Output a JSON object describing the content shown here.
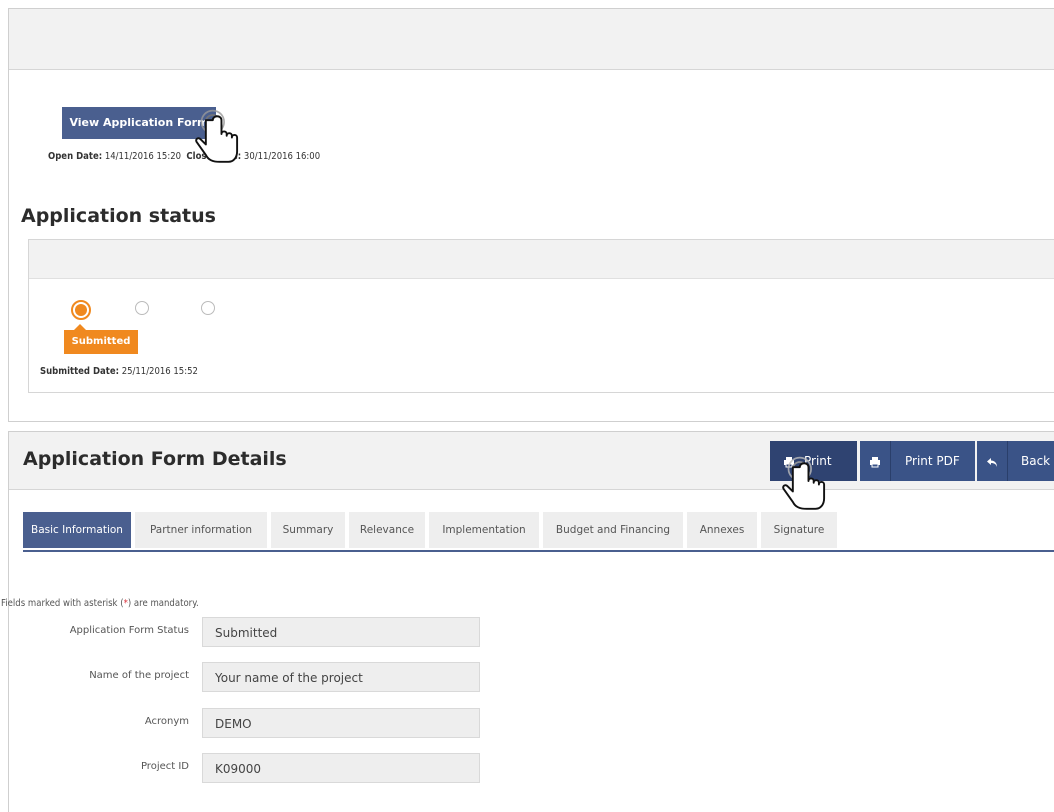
{
  "top": {
    "view_button_label": "View Application Form",
    "open_date_label": "Open Date:",
    "open_date_value": "14/11/2016 15:20",
    "close_date_label": "Close Date:",
    "close_date_value": "30/11/2016 16:00"
  },
  "status": {
    "heading": "Application status",
    "badge": "Submitted",
    "submitted_date_label": "Submitted Date:",
    "submitted_date_value": "25/11/2016 15:52"
  },
  "details": {
    "title": "Application Form Details",
    "toolbar": {
      "print": "Print",
      "print_pdf": "Print PDF",
      "back": "Back"
    },
    "tabs": [
      "Basic Information",
      "Partner information",
      "Summary",
      "Relevance",
      "Implementation",
      "Budget and Financing",
      "Annexes",
      "Signature"
    ],
    "mandatory_note_prefix": "Fields marked with asterisk (",
    "mandatory_note_asterisk": "*",
    "mandatory_note_suffix": ") are mandatory.",
    "fields": [
      {
        "label": "Application Form Status",
        "value": "Submitted"
      },
      {
        "label": "Name of the project",
        "value": "Your name of the project"
      },
      {
        "label": "Acronym",
        "value": "DEMO"
      },
      {
        "label": "Project ID",
        "value": "K09000"
      }
    ]
  },
  "colors": {
    "accent": "#4a5f8f",
    "status_orange": "#f0891f",
    "asterisk": "#d9303a"
  },
  "icons": [
    "printer-icon",
    "undo-arrow-icon",
    "hand-pointer-icon"
  ]
}
